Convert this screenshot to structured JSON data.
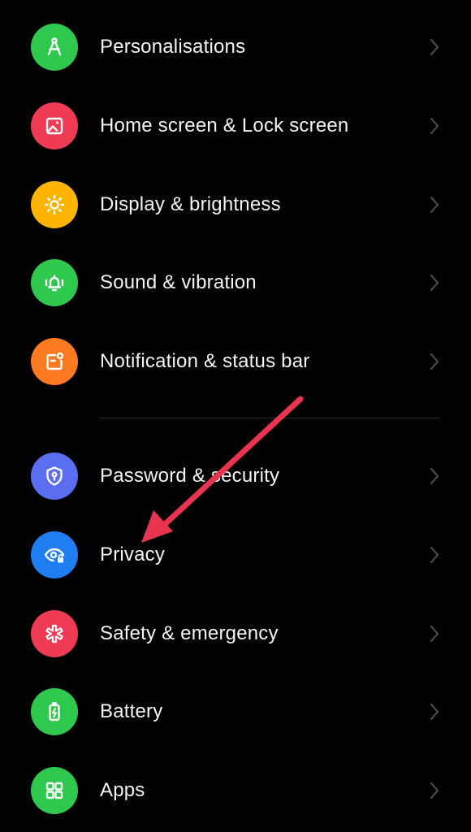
{
  "settings": {
    "items": [
      {
        "label": "Personalisations",
        "icon": "compass-icon",
        "color": "#2ec84f"
      },
      {
        "label": "Home screen & Lock screen",
        "icon": "picture-icon",
        "color": "#ef3b54"
      },
      {
        "label": "Display & brightness",
        "icon": "sun-icon",
        "color": "#ffb400"
      },
      {
        "label": "Sound & vibration",
        "icon": "bell-vibration-icon",
        "color": "#2ec84f"
      },
      {
        "label": "Notification & status bar",
        "icon": "notification-icon",
        "color": "#ff7a21"
      },
      {
        "label": "Password & security",
        "icon": "shield-icon",
        "color": "#5a6ff0"
      },
      {
        "label": "Privacy",
        "icon": "eye-lock-icon",
        "color": "#1e7ef2"
      },
      {
        "label": "Safety & emergency",
        "icon": "asterisk-icon",
        "color": "#ef3b54"
      },
      {
        "label": "Battery",
        "icon": "battery-icon",
        "color": "#2ec84f"
      },
      {
        "label": "Apps",
        "icon": "grid-icon",
        "color": "#2ec84f"
      }
    ]
  },
  "annotation": {
    "arrow_color": "#e8344e"
  }
}
